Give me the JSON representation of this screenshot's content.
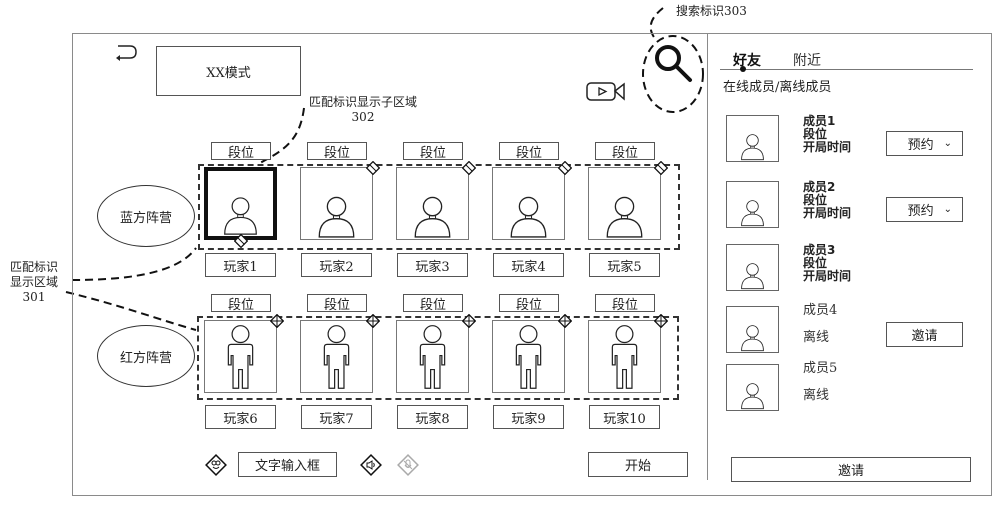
{
  "annotations": {
    "search_label": "搜索标识303",
    "sub_area_label_line1": "匹配标识显示子区域",
    "sub_area_label_line2": "302",
    "area_label_line1": "匹配标识",
    "area_label_line2": "显示区域",
    "area_label_line3": "301"
  },
  "header": {
    "back_icon": "return-arrow-icon",
    "mode_label": "XX模式",
    "video_icon": "video-camera-icon",
    "search_icon": "search-icon"
  },
  "teams": [
    {
      "name": "蓝方阵营",
      "players": [
        {
          "rank": "段位",
          "name": "玩家1",
          "selected": true,
          "avatar": "person-bust-icon"
        },
        {
          "rank": "段位",
          "name": "玩家2",
          "selected": false,
          "avatar": "person-bust-icon"
        },
        {
          "rank": "段位",
          "name": "玩家3",
          "selected": false,
          "avatar": "person-bust-icon"
        },
        {
          "rank": "段位",
          "name": "玩家4",
          "selected": false,
          "avatar": "person-bust-icon"
        },
        {
          "rank": "段位",
          "name": "玩家5",
          "selected": false,
          "avatar": "person-bust-icon"
        }
      ]
    },
    {
      "name": "红方阵营",
      "players": [
        {
          "rank": "段位",
          "name": "玩家6",
          "selected": false,
          "avatar": "person-full-body-icon"
        },
        {
          "rank": "段位",
          "name": "玩家7",
          "selected": false,
          "avatar": "person-full-body-icon"
        },
        {
          "rank": "段位",
          "name": "玩家8",
          "selected": false,
          "avatar": "person-full-body-icon"
        },
        {
          "rank": "段位",
          "name": "玩家9",
          "selected": false,
          "avatar": "person-full-body-icon"
        },
        {
          "rank": "段位",
          "name": "玩家10",
          "selected": false,
          "avatar": "person-full-body-icon"
        }
      ]
    }
  ],
  "bottom_bar": {
    "text_input_label": "文字输入框",
    "start_button": "开始",
    "icons": [
      "emoji-icon",
      "speaker-icon",
      "microphone-muted-icon"
    ]
  },
  "side_panel": {
    "tabs": [
      {
        "label": "好友",
        "active": true
      },
      {
        "label": "附近",
        "active": false
      }
    ],
    "section_title": "在线成员/离线成员",
    "members": [
      {
        "name": "成员1",
        "rank": "段位",
        "time": "开局时间",
        "online": true,
        "action": "预约"
      },
      {
        "name": "成员2",
        "rank": "段位",
        "time": "开局时间",
        "online": true,
        "action": "预约"
      },
      {
        "name": "成员3",
        "rank": "段位",
        "time": "开局时间",
        "online": true,
        "action": null
      },
      {
        "name": "成员4",
        "status": "离线",
        "online": false,
        "action": "邀请"
      },
      {
        "name": "成员5",
        "status": "离线",
        "online": false,
        "action": null
      }
    ],
    "invite_button": "邀请"
  }
}
